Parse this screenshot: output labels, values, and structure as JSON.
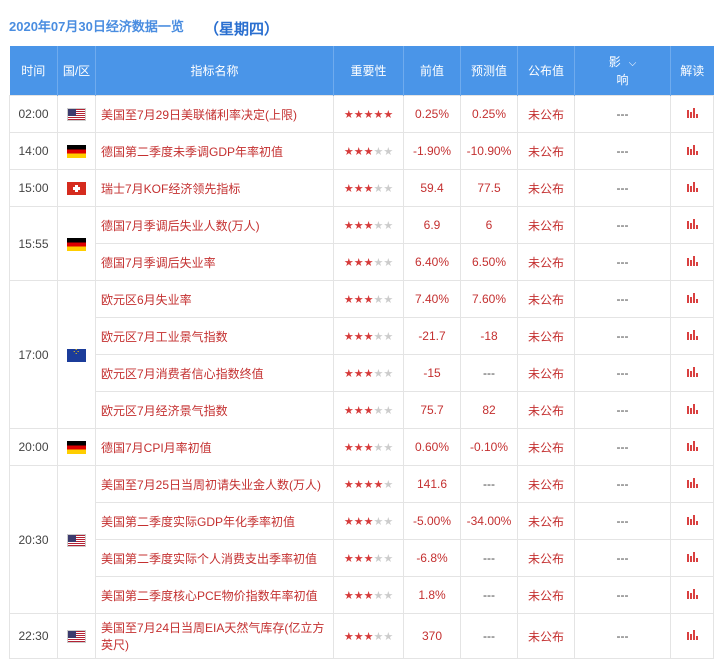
{
  "header": {
    "date_title": "2020年07月30日经济数据一览",
    "weekday": "（星期四）"
  },
  "columns": {
    "time": "时间",
    "region": "国/区",
    "indicator": "指标名称",
    "importance": "重要性",
    "previous": "前值",
    "forecast": "预测值",
    "actual": "公布值",
    "influence_top": "影",
    "influence_bottom": "响",
    "interpret": "解读"
  },
  "colors": {
    "header_bg": "#4a95e8",
    "accent_red": "#c43030",
    "star_red": "#d63a3a"
  },
  "groups": [
    {
      "time": "02:00",
      "flag": "us",
      "rows": [
        {
          "name": "美国至7月29日美联储利率决定(上限)",
          "stars": 5,
          "previous": "0.25%",
          "forecast": "0.25%",
          "actual": "未公布",
          "influence": "---"
        }
      ]
    },
    {
      "time": "14:00",
      "flag": "de",
      "rows": [
        {
          "name": "德国第二季度未季调GDP年率初值",
          "stars": 3,
          "previous": "-1.90%",
          "forecast": "-10.90%",
          "actual": "未公布",
          "influence": "---"
        }
      ]
    },
    {
      "time": "15:00",
      "flag": "ch",
      "rows": [
        {
          "name": "瑞士7月KOF经济领先指标",
          "stars": 3,
          "previous": "59.4",
          "forecast": "77.5",
          "actual": "未公布",
          "influence": "---"
        }
      ]
    },
    {
      "time": "15:55",
      "flag": "de",
      "rows": [
        {
          "name": "德国7月季调后失业人数(万人)",
          "stars": 3,
          "previous": "6.9",
          "forecast": "6",
          "actual": "未公布",
          "influence": "---"
        },
        {
          "name": "德国7月季调后失业率",
          "stars": 3,
          "previous": "6.40%",
          "forecast": "6.50%",
          "actual": "未公布",
          "influence": "---"
        }
      ]
    },
    {
      "time": "17:00",
      "flag": "eu",
      "rows": [
        {
          "name": "欧元区6月失业率",
          "stars": 3,
          "previous": "7.40%",
          "forecast": "7.60%",
          "actual": "未公布",
          "influence": "---"
        },
        {
          "name": "欧元区7月工业景气指数",
          "stars": 3,
          "previous": "-21.7",
          "forecast": "-18",
          "actual": "未公布",
          "influence": "---"
        },
        {
          "name": "欧元区7月消费者信心指数终值",
          "stars": 3,
          "previous": "-15",
          "forecast": "---",
          "actual": "未公布",
          "influence": "---"
        },
        {
          "name": "欧元区7月经济景气指数",
          "stars": 3,
          "previous": "75.7",
          "forecast": "82",
          "actual": "未公布",
          "influence": "---"
        }
      ]
    },
    {
      "time": "20:00",
      "flag": "de",
      "rows": [
        {
          "name": "德国7月CPI月率初值",
          "stars": 3,
          "previous": "0.60%",
          "forecast": "-0.10%",
          "actual": "未公布",
          "influence": "---"
        }
      ]
    },
    {
      "time": "20:30",
      "flag": "us",
      "rows": [
        {
          "name": "美国至7月25日当周初请失业金人数(万人)",
          "stars": 4,
          "previous": "141.6",
          "forecast": "---",
          "actual": "未公布",
          "influence": "---"
        },
        {
          "name": "美国第二季度实际GDP年化季率初值",
          "stars": 3,
          "previous": "-5.00%",
          "forecast": "-34.00%",
          "actual": "未公布",
          "influence": "---"
        },
        {
          "name": "美国第二季度实际个人消费支出季率初值",
          "stars": 3,
          "previous": "-6.8%",
          "forecast": "---",
          "actual": "未公布",
          "influence": "---"
        },
        {
          "name": "美国第二季度核心PCE物价指数年率初值",
          "stars": 3,
          "previous": "1.8%",
          "forecast": "---",
          "actual": "未公布",
          "influence": "---"
        }
      ]
    },
    {
      "time": "22:30",
      "flag": "us",
      "rows": [
        {
          "name": "美国至7月24日当周EIA天然气库存(亿立方英尺)",
          "stars": 3,
          "previous": "370",
          "forecast": "---",
          "actual": "未公布",
          "influence": "---",
          "tall": true
        }
      ]
    }
  ]
}
